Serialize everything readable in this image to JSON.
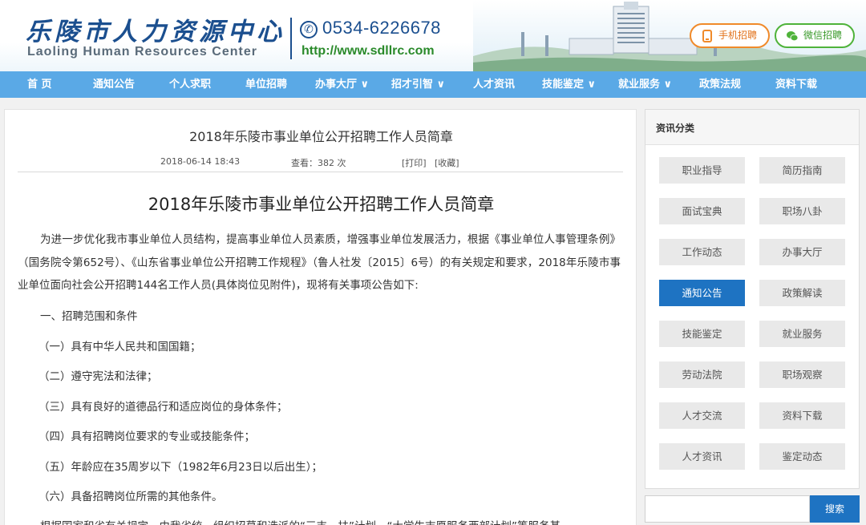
{
  "header": {
    "logo_cn": "乐陵市人力资源中心",
    "logo_en": "Laoling Human Resources Center",
    "phone": "0534-6226678",
    "url": "http://www.sdllrc.com",
    "mobile_btn": "手机招聘",
    "wechat_btn": "微信招聘"
  },
  "nav": [
    {
      "label": "首 页"
    },
    {
      "label": "通知公告"
    },
    {
      "label": "个人求职"
    },
    {
      "label": "单位招聘"
    },
    {
      "label": "办事大厅 ∨"
    },
    {
      "label": "招才引智 ∨"
    },
    {
      "label": "人才资讯"
    },
    {
      "label": "技能鉴定 ∨"
    },
    {
      "label": "就业服务 ∨"
    },
    {
      "label": "政策法规"
    },
    {
      "label": "资料下载"
    }
  ],
  "article": {
    "title": "2018年乐陵市事业单位公开招聘工作人员简章",
    "date": "2018-06-14 18:43",
    "views": "查看：382 次",
    "print": "[打印]",
    "favorite": "[收藏]",
    "heading": "2018年乐陵市事业单位公开招聘工作人员简章",
    "intro": "为进一步优化我市事业单位人员结构，提高事业单位人员素质，增强事业单位发展活力，根据《事业单位人事管理条例》（国务院令第652号）、《山东省事业单位公开招聘工作规程》（鲁人社发〔2015〕6号）的有关规定和要求，2018年乐陵市事业单位面向社会公开招聘144名工作人员(具体岗位见附件)，现将有关事项公告如下:",
    "section1": "一、招聘范围和条件",
    "items": [
      "（一）具有中华人民共和国国籍；",
      "（二）遵守宪法和法律；",
      "（三）具有良好的道德品行和适应岗位的身体条件；",
      "（四）具有招聘岗位要求的专业或技能条件；",
      "（五）年龄应在35周岁以下（1982年6月23日以后出生）；",
      "（六）具备招聘岗位所需的其他条件。"
    ],
    "last_line": "根据国家和省有关规定，由我省统一组织招募和选派的“三支一扶”计划、“大学生志愿服务西部计划”等服务基"
  },
  "sidebar": {
    "title": "资讯分类",
    "categories": [
      {
        "label": "职业指导"
      },
      {
        "label": "简历指南"
      },
      {
        "label": "面试宝典"
      },
      {
        "label": "职场八卦"
      },
      {
        "label": "工作动态"
      },
      {
        "label": "办事大厅"
      },
      {
        "label": "通知公告"
      },
      {
        "label": "政策解读"
      },
      {
        "label": "技能鉴定"
      },
      {
        "label": "就业服务"
      },
      {
        "label": "劳动法院"
      },
      {
        "label": "职场观察"
      },
      {
        "label": "人才交流"
      },
      {
        "label": "资料下载"
      },
      {
        "label": "人才资讯"
      },
      {
        "label": "鉴定动态"
      }
    ],
    "active_index": 6
  },
  "search": {
    "placeholder": "",
    "button": "搜索"
  },
  "colors": {
    "nav_bg": "#5aa9e6",
    "accent": "#1e73c2",
    "brand": "#1b4f8f"
  }
}
